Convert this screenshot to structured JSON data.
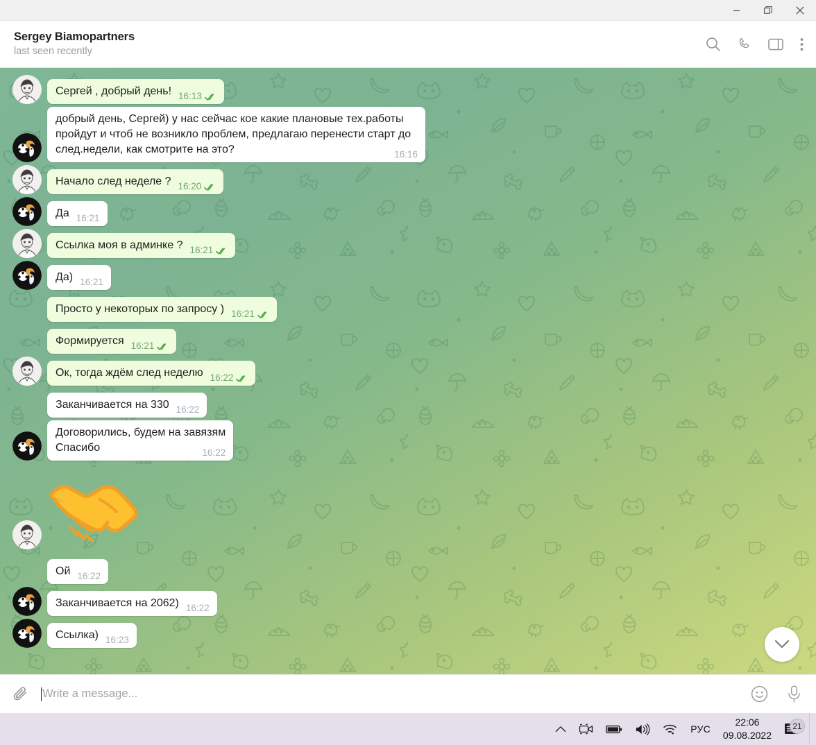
{
  "window": {
    "minimize_label": "Minimize",
    "restore_label": "Restore",
    "close_label": "Close"
  },
  "header": {
    "peer_name": "Sergey Biamopartners",
    "peer_status": "last seen recently",
    "actions": [
      "search-icon",
      "call-icon",
      "panel-icon",
      "more-icon"
    ]
  },
  "theme": {
    "outgoing_bubble": "#effdde",
    "incoming_bubble": "#ffffff",
    "tick_color": "#4fae4e",
    "out_meta_color": "#6fa86a",
    "in_meta_color": "#a6b0b8",
    "wallpaper_from": "#7fb695",
    "wallpaper_to": "#cdd97f",
    "taskbar": "#e4dfeb"
  },
  "messages": [
    {
      "id": 1,
      "side": "out",
      "avatar": "man",
      "text": "Сергей , добрый день!",
      "time": "16:13",
      "read": true,
      "multiline": false
    },
    {
      "id": 2,
      "side": "in",
      "avatar": "toucan",
      "text": "добрый день, Сергей) у нас сейчас кое какие плановые тех.работы пройдут и чтоб не возникло проблем, предлагаю перенести старт до след.недели, как смотрите на это?",
      "time": "16:16",
      "read": false,
      "multiline": true
    },
    {
      "id": 3,
      "side": "out",
      "avatar": "man",
      "text": "Начало след неделе ?",
      "time": "16:20",
      "read": true,
      "multiline": false
    },
    {
      "id": 4,
      "side": "in",
      "avatar": "toucan",
      "text": "Да",
      "time": "16:21",
      "read": false,
      "multiline": false
    },
    {
      "id": 5,
      "side": "out",
      "avatar": "man",
      "text": "Ссылка моя в админке ?",
      "time": "16:21",
      "read": true,
      "multiline": false
    },
    {
      "id": 6,
      "side": "in",
      "avatar": "toucan",
      "text": "Да)",
      "time": "16:21",
      "read": false,
      "multiline": false
    },
    {
      "id": 7,
      "side": "out",
      "avatar": "none",
      "text": "Просто у некоторых по запросу )",
      "time": "16:21",
      "read": true,
      "multiline": false
    },
    {
      "id": 8,
      "side": "out",
      "avatar": "none",
      "text": "Формируется",
      "time": "16:21",
      "read": true,
      "multiline": false
    },
    {
      "id": 9,
      "side": "out",
      "avatar": "man",
      "text": "Ок, тогда ждём след неделю",
      "time": "16:22",
      "read": true,
      "multiline": false
    },
    {
      "id": 10,
      "side": "in",
      "avatar": "none",
      "text": "Заканчивается на 330",
      "time": "16:22",
      "read": false,
      "multiline": false
    },
    {
      "id": 11,
      "side": "in",
      "avatar": "toucan",
      "text": "Договорились, будем на завязям\nСпасибо",
      "time": "16:22",
      "read": false,
      "multiline": true
    },
    {
      "id": 13,
      "side": "in",
      "avatar": "none",
      "text": "Ой",
      "time": "16:22",
      "read": false,
      "multiline": false
    },
    {
      "id": 14,
      "side": "in",
      "avatar": "toucan",
      "text": "Заканчивается на 2062)",
      "time": "16:22",
      "read": false,
      "multiline": false
    },
    {
      "id": 15,
      "side": "in",
      "avatar": "toucan",
      "text": "Ссылка)",
      "time": "16:23",
      "read": false,
      "multiline": false
    }
  ],
  "sticker": {
    "emoji": "handshake",
    "avatar": "man",
    "alt": "handshake sticker"
  },
  "scroll_button": {
    "icon": "chevron-down-icon"
  },
  "composer": {
    "attach_icon": "paperclip-icon",
    "placeholder": "Write a message...",
    "value": "",
    "emoji_icon": "smiley-icon",
    "mic_icon": "microphone-icon"
  },
  "taskbar": {
    "show_hidden_icon": "chevron-up-icon",
    "camera_icon": "camera-icon",
    "battery_icon": "battery-icon",
    "volume_icon": "volume-icon",
    "network_icon": "wifi-icon",
    "language": "РУС",
    "time": "22:06",
    "date": "09.08.2022",
    "notification_icon": "notification-icon",
    "notification_count": "21"
  }
}
